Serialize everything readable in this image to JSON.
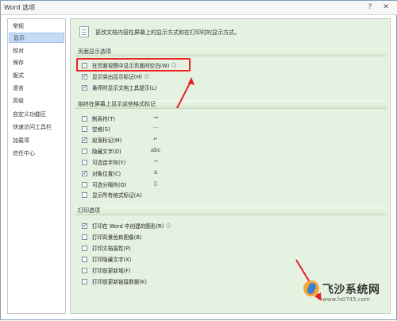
{
  "window": {
    "title": "Word 选项",
    "controls": [
      "?",
      "✕"
    ]
  },
  "sidebar": {
    "items": [
      {
        "label": "常规",
        "active": false
      },
      {
        "label": "显示",
        "active": true
      },
      {
        "label": "校对",
        "active": false
      },
      {
        "label": "保存",
        "active": false
      },
      {
        "label": "版式",
        "active": false
      },
      {
        "label": "语言",
        "active": false
      },
      {
        "label": "高级",
        "active": false
      },
      {
        "label": "自定义功能区",
        "active": false
      },
      {
        "label": "快速访问工具栏",
        "active": false
      },
      {
        "label": "加载项",
        "active": false
      },
      {
        "label": "信任中心",
        "active": false
      }
    ]
  },
  "content": {
    "description": "更改文档内容在屏幕上的显示方式和在打印时的显示方式。",
    "page_display": {
      "header": "页面显示选项",
      "options": [
        {
          "label": "在页面视图中显示页面间空白(W)",
          "checked": false,
          "info": true
        },
        {
          "label": "显示突出显示标记(H)",
          "checked": true,
          "info": true
        },
        {
          "label": "悬停时显示文档工具提示(L)",
          "checked": true,
          "info": false
        }
      ]
    },
    "format_marks": {
      "header": "始终在屏幕上显示这些格式标记",
      "options": [
        {
          "label": "制表符(T)",
          "checked": false,
          "mark": "→"
        },
        {
          "label": "空格(S)",
          "checked": false,
          "mark": "···"
        },
        {
          "label": "段落标记(M)",
          "checked": true,
          "mark": "↵"
        },
        {
          "label": "隐藏文字(D)",
          "checked": false,
          "mark": "abc"
        },
        {
          "label": "可选连字符(Y)",
          "checked": false,
          "mark": "¬"
        },
        {
          "label": "对象位置(C)",
          "checked": true,
          "mark": "⚓"
        },
        {
          "label": "可选分隔符(O)",
          "checked": false,
          "mark": "▯"
        },
        {
          "label": "显示所有格式标记(A)",
          "checked": false,
          "mark": ""
        }
      ]
    },
    "print": {
      "header": "打印选项",
      "options": [
        {
          "label": "打印在 Word 中创建的图形(R)",
          "checked": true,
          "info": true
        },
        {
          "label": "打印背景色和图像(B)",
          "checked": false
        },
        {
          "label": "打印文档属性(P)",
          "checked": false
        },
        {
          "label": "打印隐藏文字(X)",
          "checked": false
        },
        {
          "label": "打印前更新域(F)",
          "checked": false
        },
        {
          "label": "打印前更新链接数据(K)",
          "checked": false
        }
      ]
    }
  },
  "watermark": {
    "brand": "飞沙系统网",
    "url": "www.fs0745.com"
  },
  "colors": {
    "accent_red": "#e22222",
    "panel_green": "#e6f2e1",
    "selected_blue": "#c5dcf6"
  }
}
